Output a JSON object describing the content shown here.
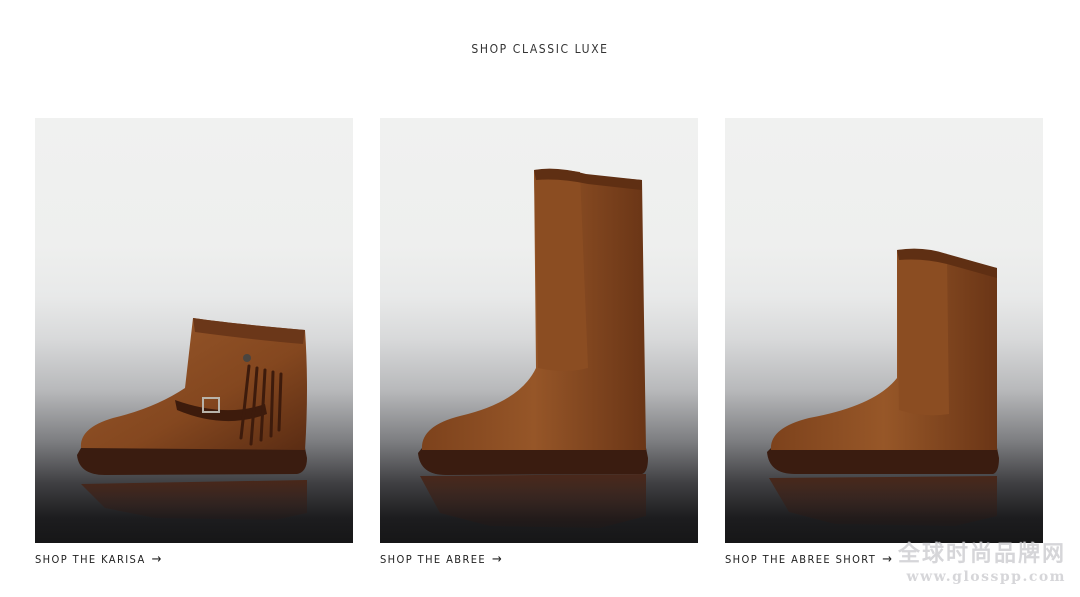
{
  "header": {
    "title": "SHOP CLASSIC LUXE"
  },
  "products": [
    {
      "name": "Karisa boot",
      "link_label": "SHOP THE KARISA",
      "arrow": "→"
    },
    {
      "name": "Abree boot",
      "link_label": "SHOP THE ABREE",
      "arrow": "→"
    },
    {
      "name": "Abree Short boot",
      "link_label": "SHOP THE ABREE SHORT",
      "arrow": "→"
    }
  ],
  "watermark": {
    "cn": "全球时尚品牌网",
    "url": "www.glosspp.com"
  },
  "colors": {
    "suede": "#8a4f26",
    "suede_dark": "#5c2f14",
    "sole": "#3a1c10",
    "background": "#ffffff"
  }
}
